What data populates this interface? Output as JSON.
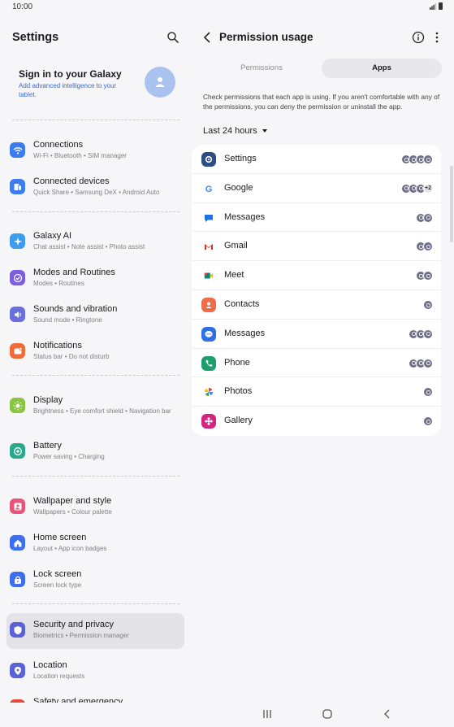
{
  "status": {
    "time": "10:00"
  },
  "left": {
    "title": "Settings",
    "signin": {
      "title": "Sign in to your Galaxy",
      "subtitle": "Add advanced intelligence to your tablet."
    },
    "items": [
      {
        "title": "Connections",
        "subtitle": "Wi-Fi  •  Bluetooth  •  SIM manager",
        "icon": "wifi-icon",
        "color": "#3d7cf0"
      },
      {
        "title": "Connected devices",
        "subtitle": "Quick Share  •  Samsung DeX  •  Android Auto",
        "icon": "devices-icon",
        "color": "#3d7cf0"
      },
      {
        "title": "Galaxy AI",
        "subtitle": "Chat assist  •  Note assist  •  Photo assist",
        "icon": "sparkle-icon",
        "color": "#3d9cf0"
      },
      {
        "title": "Modes and Routines",
        "subtitle": "Modes  •  Routines",
        "icon": "check-circle-icon",
        "color": "#7b5ce3"
      },
      {
        "title": "Sounds and vibration",
        "subtitle": "Sound mode  •  Ringtone",
        "icon": "volume-icon",
        "color": "#6a6fe0"
      },
      {
        "title": "Notifications",
        "subtitle": "Status bar  •  Do not disturb",
        "icon": "bell-icon",
        "color": "#ef6c3a"
      },
      {
        "title": "Display",
        "subtitle": "Brightness  •  Eye comfort shield  •  Navigation bar",
        "icon": "sun-icon",
        "color": "#88c540"
      },
      {
        "title": "Battery",
        "subtitle": "Power saving  •  Charging",
        "icon": "battery-icon",
        "color": "#2aa889"
      },
      {
        "title": "Wallpaper and style",
        "subtitle": "Wallpapers  •  Colour palette",
        "icon": "image-icon",
        "color": "#e8557a"
      },
      {
        "title": "Home screen",
        "subtitle": "Layout  •  App icon badges",
        "icon": "home-icon",
        "color": "#3d6ef0"
      },
      {
        "title": "Lock screen",
        "subtitle": "Screen lock type",
        "icon": "lock-icon",
        "color": "#3d6ef0"
      },
      {
        "title": "Security and privacy",
        "subtitle": "Biometrics  •  Permission manager",
        "icon": "shield-icon",
        "color": "#5a62d8"
      },
      {
        "title": "Location",
        "subtitle": "Location requests",
        "icon": "location-icon",
        "color": "#5a62d8"
      },
      {
        "title": "Safety and emergency",
        "subtitle": "",
        "icon": "emergency-icon",
        "color": "#e84a3a"
      }
    ]
  },
  "right": {
    "title": "Permission usage",
    "tabs": [
      "Permissions",
      "Apps"
    ],
    "description": "Check permissions that each app is using. If you aren't comfortable with any of the permissions, you can deny the permission or uninstall the app.",
    "filter": "Last 24 hours",
    "apps": [
      {
        "name": "Settings",
        "icon": "settings-gear-icon",
        "perms": 4,
        "extra": ""
      },
      {
        "name": "Google",
        "icon": "google-icon",
        "perms": 3,
        "extra": "+2"
      },
      {
        "name": "Messages",
        "icon": "messages-google-icon",
        "perms": 2,
        "extra": ""
      },
      {
        "name": "Gmail",
        "icon": "gmail-icon",
        "perms": 2,
        "extra": ""
      },
      {
        "name": "Meet",
        "icon": "meet-icon",
        "perms": 2,
        "extra": ""
      },
      {
        "name": "Contacts",
        "icon": "contacts-icon",
        "perms": 1,
        "extra": ""
      },
      {
        "name": "Messages",
        "icon": "messages-samsung-icon",
        "perms": 3,
        "extra": ""
      },
      {
        "name": "Phone",
        "icon": "phone-icon",
        "perms": 3,
        "extra": ""
      },
      {
        "name": "Photos",
        "icon": "photos-icon",
        "perms": 1,
        "extra": ""
      },
      {
        "name": "Gallery",
        "icon": "gallery-icon",
        "perms": 1,
        "extra": ""
      }
    ]
  }
}
